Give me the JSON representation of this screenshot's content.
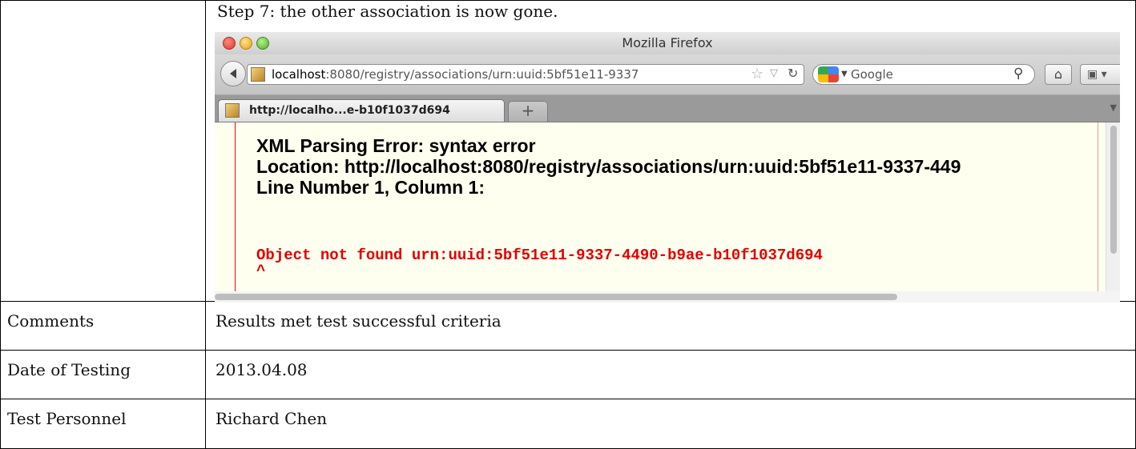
{
  "document": {
    "step_text": "Step 7: the other association is now gone.",
    "rows": [
      {
        "label": "Comments",
        "value": "Results met test successful criteria"
      },
      {
        "label": "Date of Testing",
        "value": "2013.04.08"
      },
      {
        "label": "Test Personnel",
        "value": "Richard Chen"
      }
    ]
  },
  "browser": {
    "window_title": "Mozilla Firefox",
    "url_host": "localhost",
    "url_rest": ":8080/registry/associations/urn:uuid:5bf51e11-9337",
    "search_engine": "Google",
    "tab_label": "http://localho...e-b10f1037d694",
    "new_tab_symbol": "+",
    "page": {
      "error_title": "XML Parsing Error: syntax error",
      "location": "Location: http://localhost:8080/registry/associations/urn:uuid:5bf51e11-9337-449",
      "line_info": "Line Number 1, Column 1:",
      "source_line": "Object not found urn:uuid:5bf51e11-9337-4490-b9ae-b10f1037d694",
      "caret": "^"
    }
  },
  "icons": {
    "back": "back-arrow-icon",
    "star": "star-icon",
    "reload": "reload-icon",
    "search": "magnifier-icon",
    "home": "home-icon",
    "bookmarks": "bookmarks-icon"
  },
  "colors": {
    "content_background": "#fffff0",
    "source_text": "#e00000",
    "margin_rule": "#cc1111"
  }
}
